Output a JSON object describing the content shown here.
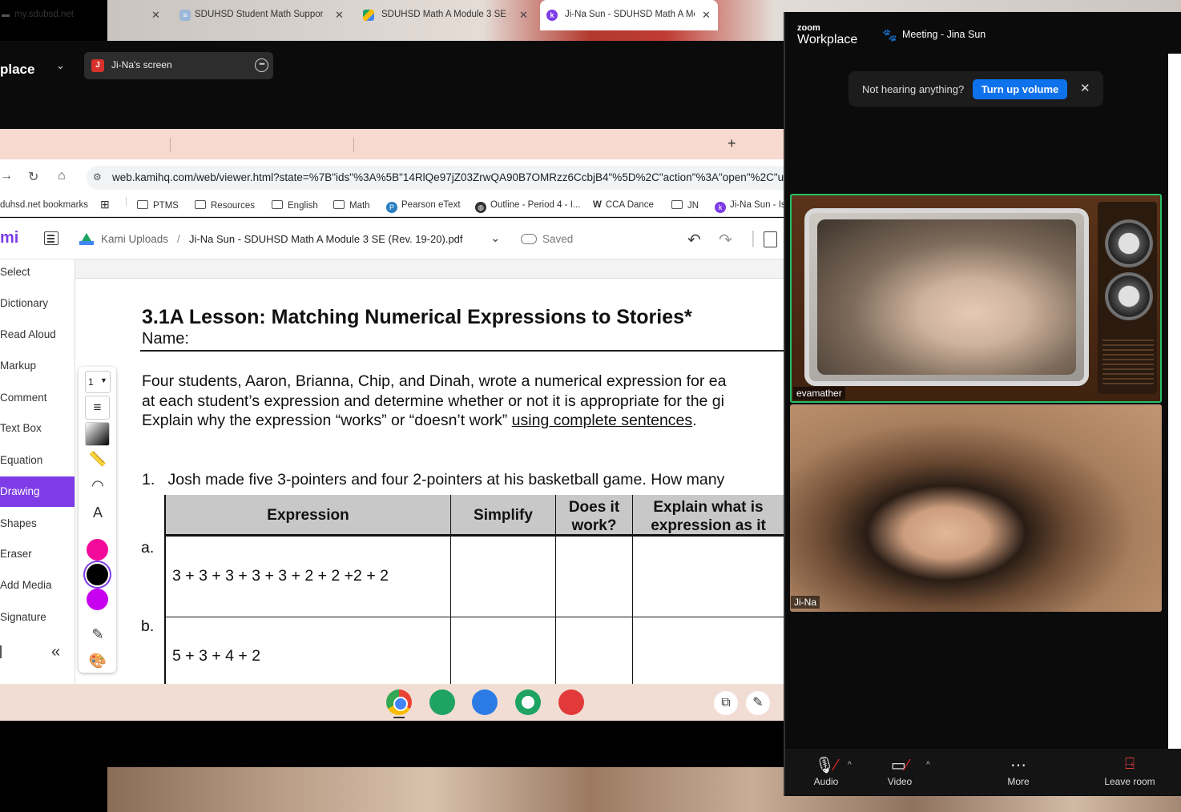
{
  "screen_share": {
    "app_label": "place",
    "sharer": "Ji-Na's screen",
    "sharer_initial": "J"
  },
  "browser": {
    "tabs": [
      {
        "title": "my.sdubsd.net"
      },
      {
        "title": "SDUHSD Student Math Support"
      },
      {
        "title": "SDUHSD Math A Module 3 SE ("
      },
      {
        "title": "Ji-Na Sun - SDUHSD Math A Mo"
      }
    ],
    "url": "web.kamihq.com/web/viewer.html?state=%7B\"ids\"%3A%5B\"14RlQe97jZ03ZrwQA90B7OMRzz6CcbjB4\"%5D%2C\"action\"%3A\"open\"%2C\"userI",
    "bookmarks": [
      "duhsd.net bookmarks",
      "PTMS",
      "Resources",
      "English",
      "Math",
      "Pearson eText",
      "Outline - Period 4 - I...",
      "CCA Dance",
      "JN",
      "Ji-Na Sun - Is"
    ]
  },
  "kami": {
    "logo": "mi",
    "breadcrumb_folder": "Kami Uploads",
    "separator": "/",
    "filename": "Ji-Na Sun - SDUHSD Math A Module 3 SE (Rev. 19-20).pdf",
    "status": "Saved",
    "sidebar": [
      "Select",
      "Dictionary",
      "Read Aloud",
      "Markup",
      "Comment",
      "Text Box",
      "Equation",
      "Drawing",
      "Shapes",
      "Eraser",
      "Add Media",
      "Signature"
    ],
    "tool_size": "1",
    "colors": {
      "accent": "#7d3ce6",
      "swatch_pink": "#f20a9a",
      "swatch_black": "#000000",
      "swatch_purple": "#c800f0"
    }
  },
  "doc": {
    "title": "3.1A Lesson: Matching Numerical Expressions to Stories*",
    "name_label": "Name:",
    "para1": "Four students, Aaron, Brianna, Chip, and Dinah, wrote a numerical expression for ea",
    "para2": "at each student’s expression and determine whether or not it is appropriate for the gi",
    "para3_a": "Explain why the expression “works” or “doesn’t work” ",
    "para3_b": "using complete sentences",
    "para3_c": ".",
    "q1_num": "1.",
    "q1": "Josh made five 3-pointers and four 2-pointers at his basketball game.  How many",
    "headers": {
      "expression": "Expression",
      "simplify": "Simplify",
      "works_1": "Does it",
      "works_2": "work?",
      "explain_1": "Explain what is",
      "explain_2": "expression as it"
    },
    "rows": [
      {
        "label": "a.",
        "expression": "3 + 3 + 3 + 3 + 3 + 2 + 2 +2 + 2"
      },
      {
        "label": "b.",
        "expression": "5 + 3 + 4 + 2"
      }
    ]
  },
  "zoom": {
    "brand_small": "zoom",
    "brand": "Workplace",
    "meeting": "Meeting - Jina Sun",
    "notice_text": "Not hearing anything?",
    "notice_button": "Turn up volume",
    "participants": [
      "evamather",
      "Ji-Na"
    ],
    "controls": [
      "Audio",
      "Video",
      "More",
      "Leave room"
    ]
  }
}
